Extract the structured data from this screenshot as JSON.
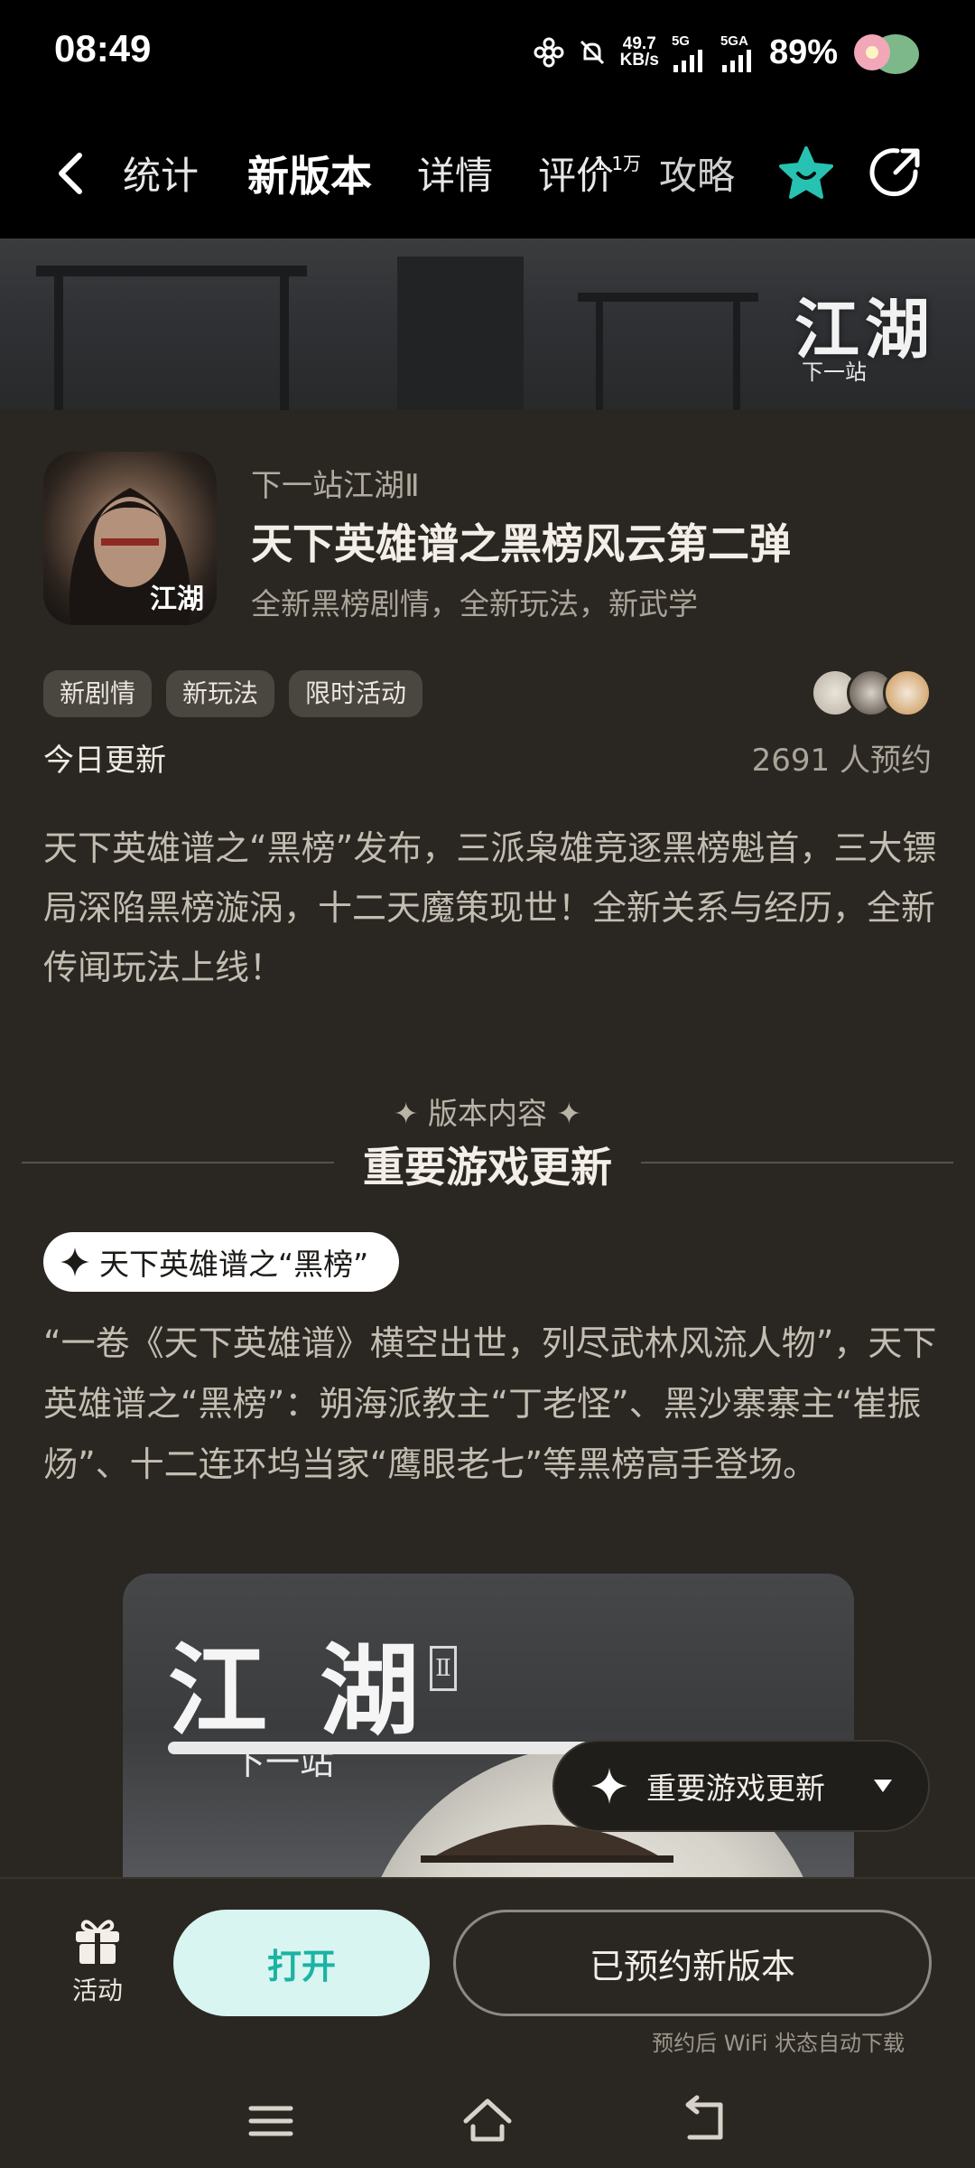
{
  "status_bar": {
    "time": "08:49",
    "net_speed_value": "49.7",
    "net_speed_unit": "KB/s",
    "net_1": "5G",
    "net_2": "5GA",
    "battery": "89%"
  },
  "nav": {
    "tabs": [
      {
        "label": "统计"
      },
      {
        "label": "新版本"
      },
      {
        "label": "详情"
      },
      {
        "label": "评价",
        "badge": "1.1万"
      },
      {
        "label": "攻略"
      }
    ],
    "active_tab": "新版本",
    "accent_color": "#27c2b1"
  },
  "banner": {
    "logo_text": "江湖",
    "logo_sub": "下一站"
  },
  "app": {
    "game_name": "下一站江湖Ⅱ",
    "version_title": "天下英雄谱之黑榜风云第二弹",
    "version_subtitle": "全新黑榜剧情，全新玩法，新武学",
    "icon_text": "江湖",
    "tags": [
      "新剧情",
      "新玩法",
      "限时活动"
    ],
    "update_label": "今日更新",
    "reserve_count": "2691 人预约",
    "description": "天下英雄谱之“黑榜”发布，三派枭雄竞逐黑榜魁首，三大镖局深陷黑榜漩涡，十二天魔策现世！全新关系与经历，全新传闻玩法上线！"
  },
  "section": {
    "kicker": "✦ 版本内容 ✦",
    "title": "重要游戏更新",
    "pill_label": "天下英雄谱之“黑榜”",
    "body": "“一卷《天下英雄谱》横空出世，列尽武林风流人物”，天下英雄谱之“黑榜”：朔海派教主“丁老怪”、黑沙寨寨主“崔振炀”、十二连环坞当家“鹰眼老七”等黑榜高手登场。"
  },
  "feature_image": {
    "logo_text": "江 湖",
    "logo_sub": "下一站",
    "logo_mark": "Ⅱ"
  },
  "float_dropdown": {
    "label": "重要游戏更新"
  },
  "bottom_bar": {
    "activity_label": "活动",
    "open_label": "打开",
    "reserved_label": "已预约新版本",
    "wifi_note": "预约后 WiFi 状态自动下载"
  }
}
